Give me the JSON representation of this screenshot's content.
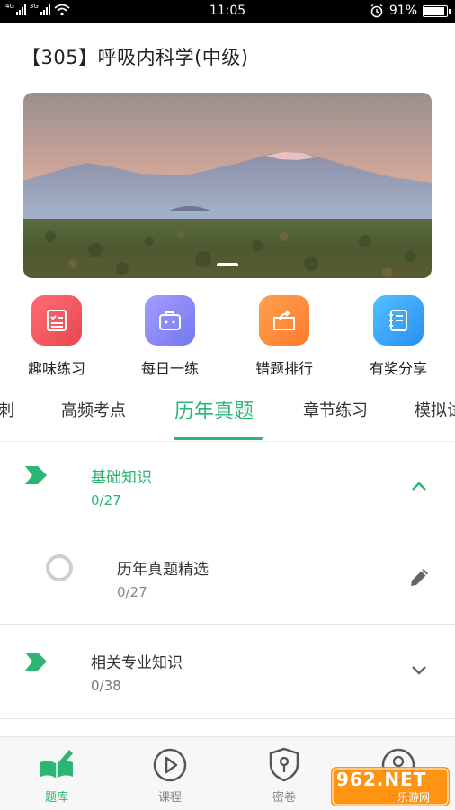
{
  "status_bar": {
    "left_labels": [
      "4G",
      "3G"
    ],
    "time": "11:05",
    "battery": "91%",
    "battery_level": 0.91
  },
  "page": {
    "title": "【305】呼吸内科学(中级)"
  },
  "banner": {
    "pages": 1,
    "active_index": 0
  },
  "shortcuts": [
    {
      "label": "趣味练习",
      "icon": "quiz-list-icon",
      "color": "#f25a66"
    },
    {
      "label": "每日一练",
      "icon": "toolbox-icon",
      "color": "#8a8af5"
    },
    {
      "label": "错题排行",
      "icon": "folder-share-icon",
      "color": "#ff8a3d"
    },
    {
      "label": "有奖分享",
      "icon": "notebook-icon",
      "color": "#3aa8f5"
    }
  ],
  "tabs": {
    "items": [
      "冲刺",
      "高频考点",
      "历年真题",
      "章节练习",
      "模拟试卷"
    ],
    "visible_items": [
      "刺",
      "高频考点",
      "历年真题",
      "章节练习",
      "模拟试"
    ],
    "active": "历年真题"
  },
  "sections": [
    {
      "title": "基础知识",
      "progress": "0/27",
      "expanded": true,
      "children": [
        {
          "title": "历年真题精选",
          "progress": "0/27"
        }
      ]
    },
    {
      "title": "相关专业知识",
      "progress": "0/38",
      "expanded": false
    }
  ],
  "bottom_nav": [
    {
      "label": "题库",
      "icon": "book-pen-icon",
      "active": true
    },
    {
      "label": "课程",
      "icon": "play-circle-icon",
      "active": false
    },
    {
      "label": "密卷",
      "icon": "shield-key-icon",
      "active": false
    },
    {
      "label": "我的",
      "icon": "user-icon",
      "active": false
    }
  ],
  "watermark": {
    "text": "962.NET",
    "subtext": "乐游网"
  },
  "colors": {
    "accent": "#2bb673",
    "text": "#222222",
    "muted": "#777777"
  }
}
